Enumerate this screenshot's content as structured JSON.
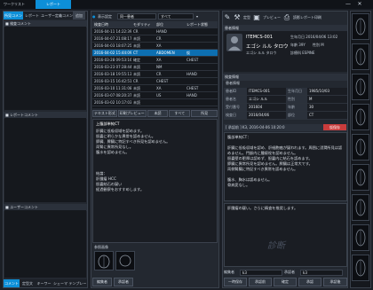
{
  "top_tabs": [
    "ワークリスト",
    "レポート"
  ],
  "left_panel": {
    "tabs": [
      "所見コメント",
      "レポート",
      "ユーザー定義コメント",
      "追加"
    ],
    "sections": [
      "検査コメント",
      "レポートコメント",
      "ユーザーコメント"
    ],
    "bottom_tabs": [
      "コメント",
      "定型文",
      "キーワード",
      "シェーマ",
      "テンプレート"
    ]
  },
  "filter": {
    "label1": "表示設定",
    "value1": "同一患者",
    "value2": "すべて"
  },
  "study_table": {
    "headers": [
      "検査日時",
      "モダリティ",
      "部位",
      "レポート状態"
    ],
    "rows": [
      [
        "2016-04-11 14:22:39",
        "CR",
        "HAND",
        ""
      ],
      [
        "2016-04-07 21:08:17",
        "未読",
        "CR",
        ""
      ],
      [
        "2016-04-03 18:07:25",
        "未読",
        "XA",
        ""
      ],
      [
        "2016-04-02 15:44:09",
        "CT",
        "ABDOMEN",
        "仮"
      ],
      [
        "2016-03-28 09:53:16",
        "確定",
        "XA",
        "CHEST"
      ],
      [
        "2016-03-23 07:28:44",
        "未読",
        "NM",
        ""
      ],
      [
        "2016-03-18 19:55:13",
        "未読",
        "CR",
        "HAND"
      ],
      [
        "2016-03-15 16:42:51",
        "CR",
        "CHEST",
        ""
      ],
      [
        "2016-03-10 11:31:08",
        "未読",
        "XA",
        "CHEST"
      ],
      [
        "2016-03-07 08:20:37",
        "未読",
        "US",
        "HAND"
      ],
      [
        "2016-03-02 10:17:03",
        "未読",
        "",
        ""
      ]
    ],
    "selected_index": 3
  },
  "report_toolbar": [
    "テキスト形式",
    "印刷プレビュー",
    "未読",
    "すべて",
    "所見"
  ],
  "finding": {
    "title": "上腹部単純CT",
    "body": "肝臓に低吸収域を認めます。\n胆嚢に明らかな異常を認めません。\n膵臓、脾臓に特記すべき所見を認めません。\n両腎に異常所見なし。\n腹水を認めません。\n\n\n\n結論：\n肝腫瘤 HCC\n胆嚢結石の疑い\n経過観察をおすすめします。"
  },
  "ref_images_label": "参照画像",
  "left_bottom": {
    "label1": "編集者",
    "label2": "承認者"
  },
  "header_tools": [
    "ペン",
    "定型",
    "プレビュー",
    "読影レポート印刷"
  ],
  "patient": {
    "section": "患者情報",
    "id": "ITEMCS-001",
    "name_kana": "エゴシ ルル タロウ",
    "name": "エゴシ ルル タロウ",
    "birth": "生年月日 2016/04/06 13:02",
    "age": "年齢 39Y",
    "sex": "性別 M",
    "dept": "診療科 ESPINE"
  },
  "study_info": {
    "section": "検査情報",
    "sub": "患者情報",
    "fields": [
      [
        "患者ID",
        "ITEMCS-001",
        "生年月日",
        "1985/10/03"
      ],
      [
        "患者名",
        "エゴシ ルル",
        "性別",
        "M"
      ],
      [
        "受付番号",
        "201604",
        "年齢",
        "30"
      ],
      [
        "検査日",
        "2016/04/06",
        "部位",
        "CT"
      ]
    ]
  },
  "right_report": {
    "title": "[ 承認前 ] K3, 2016-04-06 10:20:0",
    "status": "仮保存",
    "body": "腹部単純CT：\n\n肝臓に低吸収域を認め、肝細胞癌が疑われます。周囲に浸潤所見は認めません。門脈内に腫瘍栓を認めません。\n胆嚢壁の肥厚は認めず、胆嚢内に結石を認めます。\n膵臓に異常所見を認めません。脾臓は正常大です。\n両側腎臓に特記すべき異常を認めません。\n\n腹水、胸水は認めません。\n骨病変なし。",
    "impression": "肝腫瘤の疑い。さらに精査を推奨します。",
    "editor_label": "編集者",
    "editor": "k3",
    "approver_label": "承認者",
    "approver": "k3",
    "watermark": "診断"
  },
  "bottom_buttons": [
    "一時保存",
    "承認前",
    "確定",
    "承認",
    "承認後"
  ],
  "thumb_count": 9
}
